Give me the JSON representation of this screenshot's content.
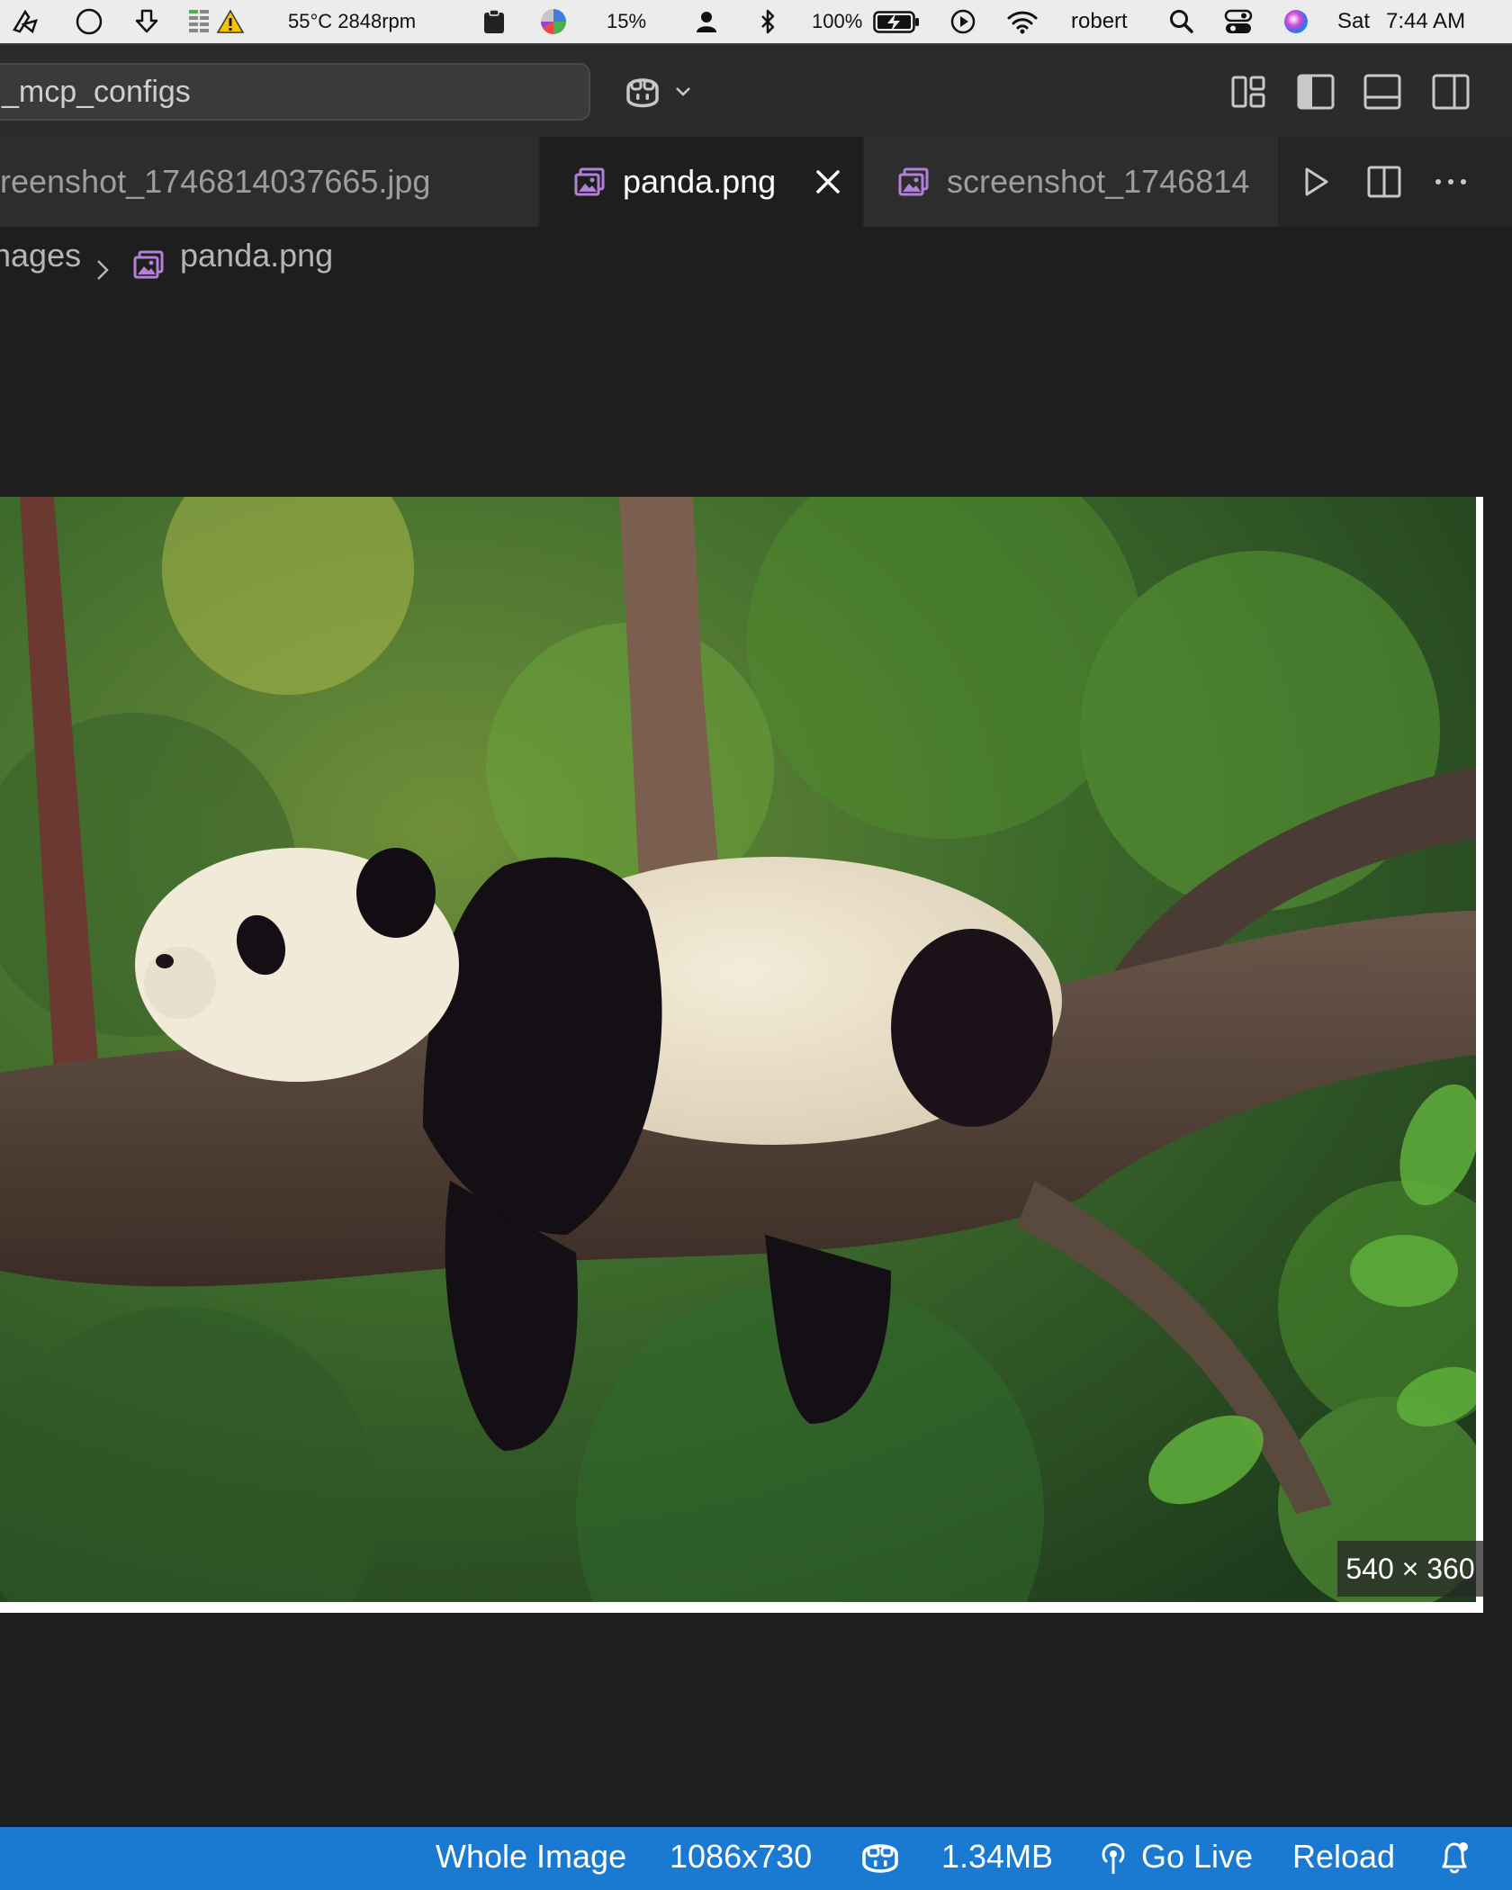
{
  "menubar": {
    "temperature_fan": "55°C 2848rpm",
    "cpu_percent": "15%",
    "battery_percent": "100%",
    "user": "robert",
    "day": "Sat",
    "time": "7:44 AM"
  },
  "titlebar": {
    "search_text": "_mcp_configs"
  },
  "tabs": [
    {
      "label": "reenshot_1746814037665.jpg",
      "active": false
    },
    {
      "label": "panda.png",
      "active": true
    },
    {
      "label": "screenshot_1746814",
      "active": false
    }
  ],
  "breadcrumb": {
    "folder": "nages",
    "file": "panda.png"
  },
  "preview": {
    "dimensions_badge": "540 × 360"
  },
  "statusbar": {
    "zoom_mode": "Whole Image",
    "image_size": "1086x730",
    "file_size": "1.34MB",
    "go_live": "Go Live",
    "reload": "Reload"
  },
  "colors": {
    "editor_bg": "#1e1e1e",
    "statusbar_bg": "#1a7ad1",
    "tab_icon_accent": "#b180d7",
    "menubar_bg": "#ececec"
  },
  "icons": [
    "cursor-ext-icon",
    "circle-icon",
    "download-arrow-icon",
    "warning-icon",
    "clipboard-icon",
    "pie-chart-icon",
    "person-icon",
    "bluetooth-icon",
    "battery-charging-icon",
    "play-circle-icon",
    "wifi-icon",
    "search-icon",
    "control-center-icon",
    "siri-icon",
    "copilot-icon",
    "chevron-down-icon",
    "layout-customize-icon",
    "toggle-primary-sidebar-icon",
    "toggle-panel-icon",
    "toggle-secondary-sidebar-icon",
    "image-file-icon",
    "close-icon",
    "run-icon",
    "split-editor-icon",
    "more-actions-icon",
    "chevron-right-icon",
    "broadcast-icon",
    "bell-icon"
  ]
}
